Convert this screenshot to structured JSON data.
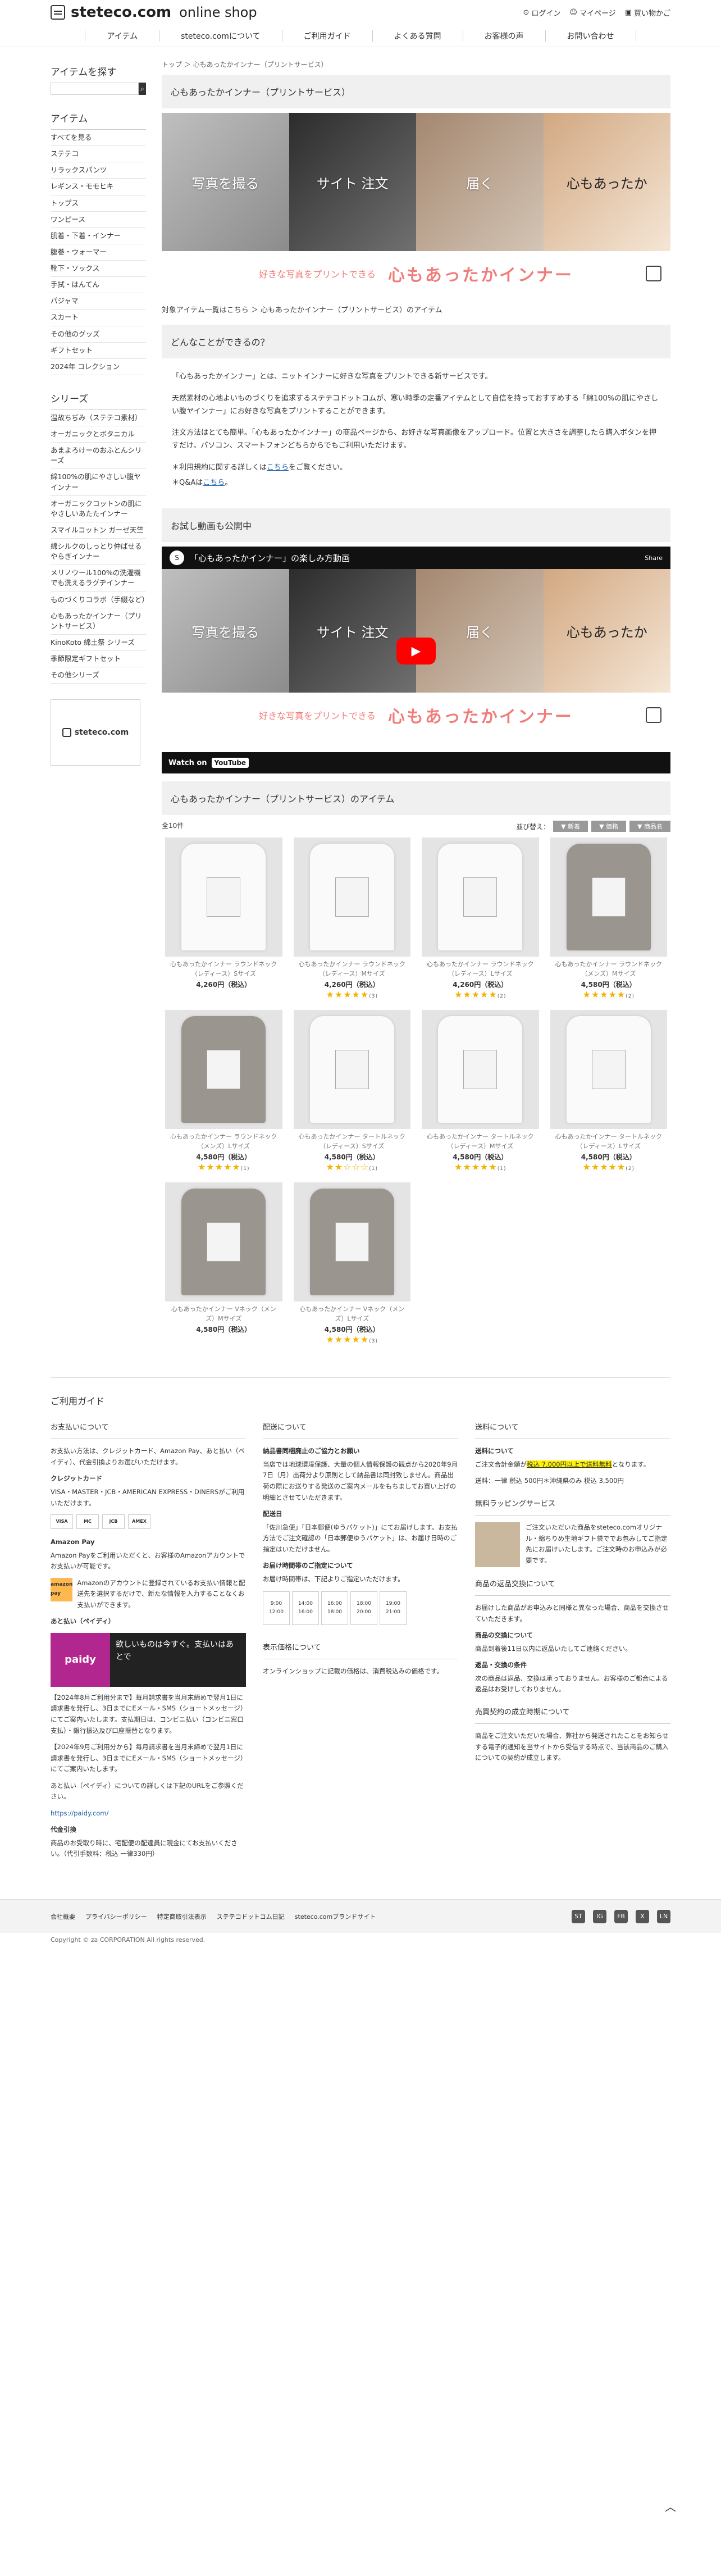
{
  "header": {
    "logo": "steteco.com",
    "logo_sub": "online shop",
    "login": "ログイン",
    "mypage": "マイページ",
    "cart": "買い物かご"
  },
  "nav": [
    "アイテム",
    "steteco.comについて",
    "ご利用ガイド",
    "よくある質問",
    "お客様の声",
    "お問い合わせ"
  ],
  "sidebar": {
    "search_title": "アイテムを探す",
    "search_button": "検索",
    "item_title": "アイテム",
    "items": [
      "すべてを見る",
      "ステテコ",
      "リラックスパンツ",
      "レギンス・モモヒキ",
      "トップス",
      "ワンピース",
      "肌着・下着・インナー",
      "腹巻・ウォーマー",
      "靴下・ソックス",
      "手拭・はんてん",
      "パジャマ",
      "スカート",
      "その他のグッズ",
      "ギフトセット",
      "2024年 コレクション"
    ],
    "series_title": "シリーズ",
    "series": [
      "温故ちぢみ（ステテコ素材）",
      "オーガニックとボタニカル",
      "あまよろけーのおふとんシリーズ",
      "綿100%の肌にやさしい腹ヤインナー",
      "オーガニックコットンの肌にやさしいあたたインナー",
      "スマイルコットン ガーゼ天竺",
      "綿シルクのしっとり仲ばせるやらぎインナー",
      "メリノウール100%の洗濯機でも洗えるラグヂインナー",
      "ものづくりコラボ（手綴など）",
      "心もあったかインナー（プリントサービス）",
      "KinoKoto 綿土祭 シリーズ",
      "季節限定ギフトセット",
      "その他シリーズ"
    ],
    "banner": "steteco.com"
  },
  "main": {
    "breadcrumb": "トップ ＞ 心もあったかインナー（プリントサービス）",
    "title": "心もあったかインナー（プリントサービス）",
    "hero": [
      "写真を撮る",
      "サイト 注文",
      "届く",
      "心もあったか"
    ],
    "tagline_small": "好きな写真をプリントできる",
    "tagline_big": "心もあったかインナー",
    "sub_link": "対象アイテム一覧はこちら ＞ 心もあったかインナー（プリントサービス）のアイテム",
    "what_title": "どんなことができるの？",
    "para1": "「心もあったかインナー」とは、ニットインナーに好きな写真をプリントできる新サービスです。",
    "para2": "天然素材の心地よいものづくりを追求するステテコドットコムが、寒い時季の定番アイテムとして自信を持っておすすめする「綿100%の肌にやさしい腹ヤインナー」にお好きな写真をプリントすることができます。",
    "para3": "注文方法はとても簡単。「心もあったかインナー」の商品ページから、お好きな写真画像をアップロード。位置と大きさを調整したら購入ボタンを押すだけ。パソコン、スマートフォンどちらからでもご利用いただけます。",
    "note1_pre": "＊利用規約に関する詳しくは",
    "note1_link": "こちら",
    "note1_post": "をご覧ください。",
    "note2_pre": "＊Q&Aは",
    "note2_link": "こちら",
    "note2_post": "。",
    "video_section": "お試し動画も公開中",
    "video_title": "「心もあったかインナー」の楽しみ方動画",
    "video_share": "Share",
    "video_watch": "Watch on",
    "video_yt": "YouTube",
    "items_title": "心もあったかインナー（プリントサービス）のアイテム",
    "count": "全10件",
    "sort_label": "並び替え：",
    "sort": [
      "▼ 新着",
      "▼ 価格",
      "▼ 商品名"
    ]
  },
  "products": [
    {
      "name": "心もあったかインナー ラウンドネック（レディース）Sサイズ",
      "price": "4,260円（税込）",
      "rating": 0,
      "reviews": "",
      "gray": false
    },
    {
      "name": "心もあったかインナー ラウンドネック（レディース）Mサイズ",
      "price": "4,260円（税込）",
      "rating": 5,
      "reviews": "(3)",
      "gray": false
    },
    {
      "name": "心もあったかインナー ラウンドネック（レディース）Lサイズ",
      "price": "4,260円（税込）",
      "rating": 5,
      "reviews": "(2)",
      "gray": false
    },
    {
      "name": "心もあったかインナー ラウンドネック（メンズ）Mサイズ",
      "price": "4,580円（税込）",
      "rating": 5,
      "reviews": "(2)",
      "gray": true
    },
    {
      "name": "心もあったかインナー ラウンドネック（メンズ）Lサイズ",
      "price": "4,580円（税込）",
      "rating": 5,
      "reviews": "(1)",
      "gray": true
    },
    {
      "name": "心もあったかインナー タートルネック（レディース）Sサイズ",
      "price": "4,580円（税込）",
      "rating": 2,
      "reviews": "(1)",
      "gray": false
    },
    {
      "name": "心もあったかインナー タートルネック（レディース）Mサイズ",
      "price": "4,580円（税込）",
      "rating": 5,
      "reviews": "(1)",
      "gray": false
    },
    {
      "name": "心もあったかインナー タートルネック（レディース）Lサイズ",
      "price": "4,580円（税込）",
      "rating": 5,
      "reviews": "(2)",
      "gray": false
    },
    {
      "name": "心もあったかインナー Vネック（メンズ）Mサイズ",
      "price": "4,580円（税込）",
      "rating": 0,
      "reviews": "",
      "gray": true
    },
    {
      "name": "心もあったかインナー Vネック（メンズ）Lサイズ",
      "price": "4,580円（税込）",
      "rating": 5,
      "reviews": "(3)",
      "gray": true
    }
  ],
  "guide": {
    "title": "ご利用ガイド",
    "pay_title": "お支払いについて",
    "pay_text": "お支払い方法は、クレジットカード、Amazon Pay、あと払い（ペイディ）、代金引換よりお選びいただけます。",
    "credit_title": "クレジットカード",
    "credit_text": "VISA・MASTER・JCB・AMERICAN EXPRESS・DINERSがご利用いただけます。",
    "cards": [
      "VISA",
      "MC",
      "JCB",
      "AMEX"
    ],
    "amazon_title": "Amazon Pay",
    "amazon_text": "Amazon Payをご利用いただくと、お客様のAmazonアカウントでお支払いが可能です。",
    "amazon_logo": "amazon pay",
    "amazon_text2": "Amazonのアカウントに登録されているお支払い情報と配送先を選択するだけで、新たな情報を入力することなくお支払いができます。",
    "paidy_title": "あと払い（ペイディ）",
    "paidy_logo": "paidy",
    "paidy_copy": "欲しいものは今すぐ。支払いはあとで",
    "paidy_text": "【2024年8月ご利用分まで】毎月請求書を当月末締めで翌月1日に請求書を発行し、3日までにEメール・SMS（ショートメッセージ）にてご案内いたします。支払期日は、コンビニ払い（コンビニ窓口支払）・銀行振込及び口座振替となります。",
    "paidy_text2": "【2024年9月ご利用分から】毎月請求書を当月末締めで翌月1日に請求書を発行し、3日までにEメール・SMS（ショートメッセージ）にてご案内いたします。",
    "paidy_text3": "あと払い（ペイディ）についての詳しくは下記のURLをご参照ください。",
    "paidy_url": "https://paidy.com/",
    "cod_title": "代金引換",
    "cod_text": "商品のお受取り時に、宅配便の配達員に現金にてお支払いください。（代引手数料：税込 一律330円）",
    "ship_title": "配送について",
    "ship_sub1": "納品書同梱廃止のご協力とお願い",
    "ship_text1": "当店では地球環境保護、大量の個人情報保護の観点から2020年9月7日（月）出荷分より原則として納品書は同封致しません。商品出荷の際にお送りする発送のご案内メールをもちましてお買い上げの明細とさせていただきます。",
    "ship_sub2": "配送日",
    "ship_text2": "「佐川急便」「日本郵便(ゆうパケット)」にてお届けします。お支払方法でご注文確認の「日本郵便ゆうパケット」は、お届け日時のご指定はいただけません。",
    "time_title": "お届け時間帯のご指定について",
    "time_text": "お届け時間帯は、下記よりご指定いただけます。",
    "clocks": [
      "9:00\n12:00",
      "14:00\n16:00",
      "16:00\n18:00",
      "18:00\n20:00",
      "19:00\n21:00"
    ],
    "price_title": "表示価格について",
    "price_text": "オンラインショップに記載の価格は、消費税込みの価格です。",
    "fee_title": "送料について",
    "fee_sub": "送料について",
    "fee_text_pre": "ご注文合計金額が",
    "fee_text_mark": "税込 7,000円以上で送料無料",
    "fee_text_post": "となります。",
    "fee_text2": "送料：一律 税込 500円＊沖縄県のみ 税込 3,500円",
    "wrap_title": "無料ラッピングサービス",
    "wrap_text": "ご注文いただいた商品をsteteco.comオリジナル・綿ちりめ生地ギフト袋ででお包みしてご指定先にお届けいたします。ご注文時のお申込みが必要です。",
    "return_title": "商品の返品交換について",
    "return_text": "お届けした商品がお申込みと同様と異なった場合、商品を交換させていただきます。",
    "return_sub1": "商品の交換について",
    "return_text1": "商品到着後11日以内に返品いたしてご連絡ください。",
    "return_sub2": "返品・交換の条件",
    "return_text2": "次の商品は返品、交換は承っておりません。お客様のご都合による返品はお受けしておりません。",
    "contract_title": "売買契約の成立時期について",
    "contract_text": "商品をご注文いただいた場合、弊社から発送されたことをお知らせする電子的通知を当サイトから受信する時点で、当該商品のご購入についての契約が成立します。"
  },
  "footer": {
    "links": [
      "会社概要",
      "プライバシーポリシー",
      "特定商取引法表示",
      "ステテコドットコム日記",
      "steteco.comブランドサイト"
    ],
    "sns": [
      "ST",
      "IG",
      "FB",
      "X",
      "LN"
    ],
    "copyright": "Copyright © za CORPORATION All rights reserved.",
    "totop": "︿"
  }
}
